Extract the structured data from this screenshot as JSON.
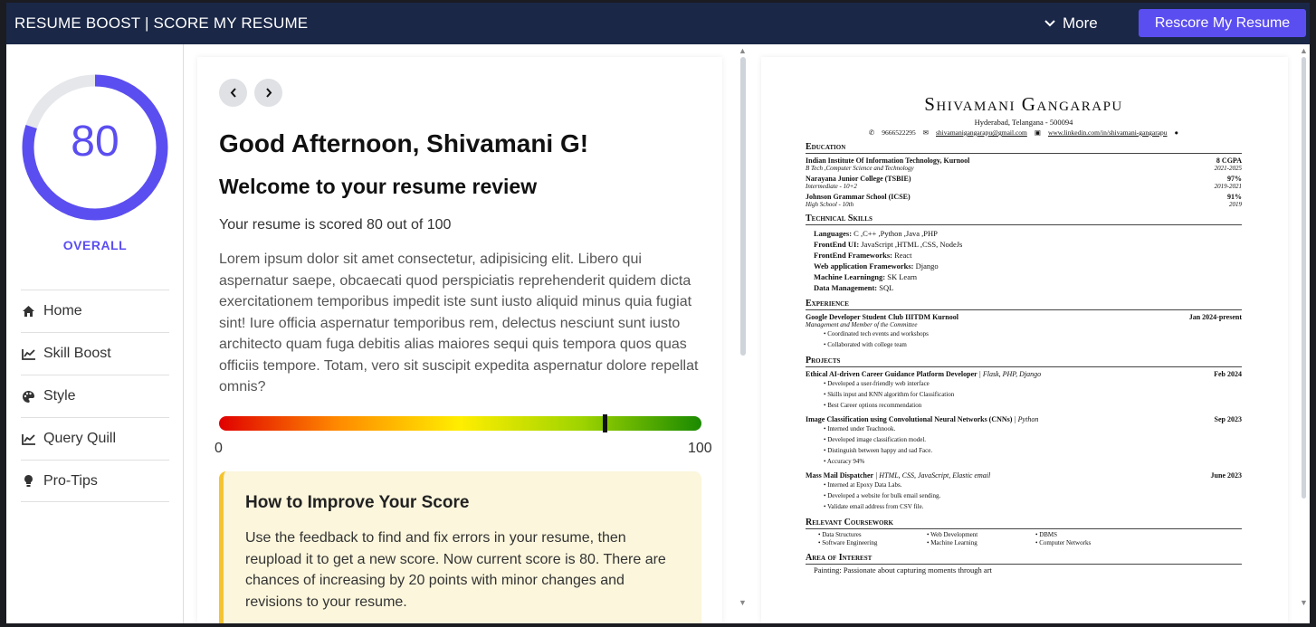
{
  "topbar": {
    "title": "RESUME BOOST | SCORE MY RESUME",
    "more_label": "More",
    "rescore_label": "Rescore My Resume"
  },
  "sidebar": {
    "score": "80",
    "score_fraction": 0.8,
    "overall_label": "OVERALL",
    "accent_color": "#5b4ef0",
    "nav": [
      {
        "label": "Home",
        "icon": "home-icon"
      },
      {
        "label": "Skill Boost",
        "icon": "chart-line-icon"
      },
      {
        "label": "Style",
        "icon": "palette-icon"
      },
      {
        "label": "Query Quill",
        "icon": "chart-line-icon"
      },
      {
        "label": "Pro-Tips",
        "icon": "lightbulb-icon"
      }
    ]
  },
  "main": {
    "greeting": "Good Afternoon, Shivamani G!",
    "welcome": "Welcome to your resume review",
    "score_line": "Your resume is scored 80 out of 100",
    "lorem": "Lorem ipsum dolor sit amet consectetur, adipisicing elit. Libero qui aspernatur saepe, obcaecati quod perspiciatis reprehenderit quidem dicta exercitationem temporibus impedit iste sunt iusto aliquid minus quia fugiat sint! Iure officia aspernatur temporibus rem, delectus nesciunt sunt iusto architecto quam fuga debitis alias maiores sequi quis tempora quos quas officiis tempore. Totam, vero sit suscipit expedita aspernatur dolore repellat omnis?",
    "bar_min": "0",
    "bar_max": "100",
    "bar_value": 80,
    "tip_title": "How to Improve Your Score",
    "tip_body": "Use the feedback to find and fix errors in your resume, then reupload it to get a new score. Now current score is 80. There are chances of increasing by 20 points with minor changes and revisions to your resume."
  },
  "resume": {
    "name": "Shivamani Gangarapu",
    "address": "Hyderabad, Telangana - 500094",
    "phone": "9666522295",
    "email": "shivamanigangarapu@gmail.com",
    "linkedin": "www.linkedin.com/in/shivamani-gangarapu",
    "sec_education": "Education",
    "edu": [
      {
        "school": "Indian Institute Of Information Technology, Kurnool",
        "grade": "8 CGPA",
        "degree": "B Tech ,Computer Science and Technology",
        "years": "2021-2025"
      },
      {
        "school": "Narayana Junior College (TSBIE)",
        "grade": "97%",
        "degree": "Intermediate - 10+2",
        "years": "2019-2021"
      },
      {
        "school": "Johnson Grammar School (ICSE)",
        "grade": "91%",
        "degree": "High School - 10th",
        "years": "2019"
      }
    ],
    "sec_skills": "Technical Skills",
    "skills": [
      {
        "k": "Languages:",
        "v": " C ,C++ ,Python ,Java ,PHP"
      },
      {
        "k": "FrontEnd UI:",
        "v": " JavaScript ,HTML ,CSS, NodeJs"
      },
      {
        "k": "FrontEnd Frameworks:",
        "v": " React"
      },
      {
        "k": "Web application Frameworks:",
        "v": " Django"
      },
      {
        "k": "Machine Learningng:",
        "v": " SK Learn"
      },
      {
        "k": "Data Management:",
        "v": " SQL"
      }
    ],
    "sec_experience": "Experience",
    "exp_title": "Google Developer Student Club IIITDM Kurnool",
    "exp_date": "Jan 2024-present",
    "exp_role": "Management and Member of the Committee",
    "exp_b1": "Coordinated tech events and workshops",
    "exp_b2": "Collaborated with college team",
    "sec_projects": "Projects",
    "p1_title": "Ethical AI-driven Career Guidance Platform Developer",
    "p1_tech": " | Flask, PHP, Django",
    "p1_date": "Feb 2024",
    "p1_b1": "Developed a user-friendly web interface",
    "p1_b2": "Skills input and KNN algorithm for Classification",
    "p1_b3": "Best Career options recommendation",
    "p2_title": "Image Classification using Convolutional Neural Networks (CNNs)",
    "p2_tech": " | Python",
    "p2_date": "Sep 2023",
    "p2_b1": "Interned under Teachnook.",
    "p2_b2": "Developed image classification model.",
    "p2_b3": "Distinguish between happy and sad Face.",
    "p2_b4": "Accuracy 94%",
    "p3_title": "Mass Mail Dispatcher",
    "p3_tech": " | HTML, CSS, JavaScript, Elastic email",
    "p3_date": "June 2023",
    "p3_b1": "Interned at Epoxy Data Labs.",
    "p3_b2": "Developed a website for bulk email sending.",
    "p3_b3": "Validate email address from CSV file.",
    "sec_coursework": "Relevant Coursework",
    "cw1": "Data Structures",
    "cw2": "Web Development",
    "cw3": "DBMS",
    "cw4": "Software Engineering",
    "cw5": "Machine Learning",
    "cw6": "Computer Networks",
    "sec_interest": "Area of Interest",
    "interest": "Painting: Passionate about capturing moments through art"
  }
}
